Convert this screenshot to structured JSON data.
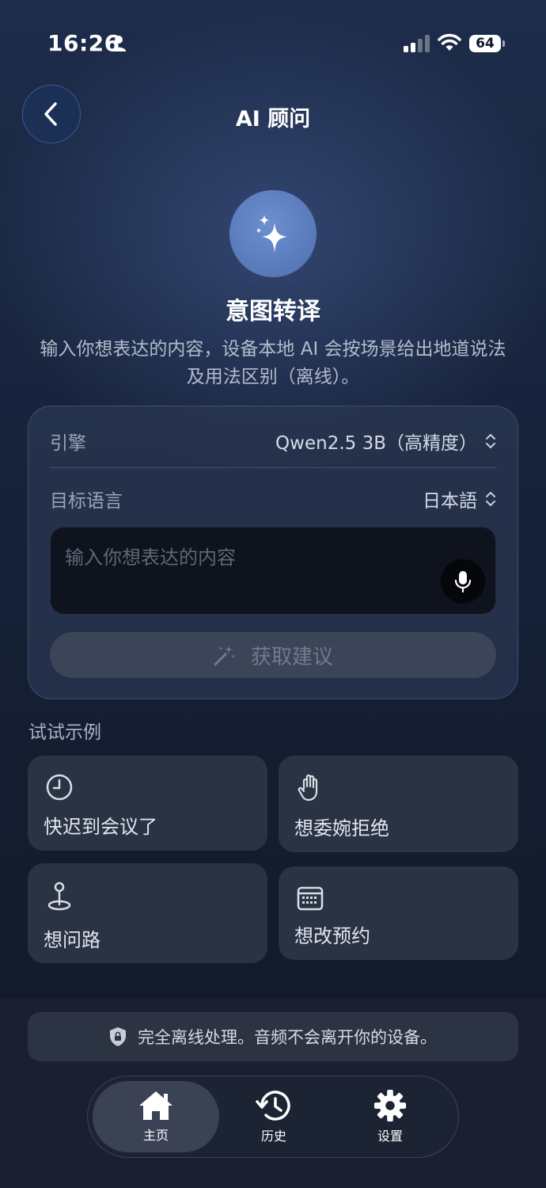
{
  "status_bar": {
    "time": "16:26",
    "battery": "64"
  },
  "header": {
    "title": "AI 顾问"
  },
  "hero": {
    "title": "意图转译",
    "description": "输入你想表达的内容，设备本地 AI 会按场景给出地道说法及用法区别（离线）。"
  },
  "form": {
    "engine_label": "引擎",
    "engine_value": "Qwen2.5 3B（高精度）",
    "language_label": "目标语言",
    "language_value": "日本語",
    "input_placeholder": "输入你想表达的内容",
    "input_value": "",
    "submit_label": "获取建议"
  },
  "examples": {
    "title": "试试示例",
    "items": [
      {
        "label": "快迟到会议了",
        "icon": "clock-icon"
      },
      {
        "label": "想委婉拒绝",
        "icon": "hand-icon"
      },
      {
        "label": "想问路",
        "icon": "map-pin-icon"
      },
      {
        "label": "想改预约",
        "icon": "calendar-icon"
      }
    ]
  },
  "footer": {
    "offline_note": "完全离线处理。音频不会离开你的设备。"
  },
  "tabbar": {
    "items": [
      {
        "label": "主页",
        "icon": "home-icon",
        "active": true
      },
      {
        "label": "历史",
        "icon": "history-icon",
        "active": false
      },
      {
        "label": "设置",
        "icon": "gear-icon",
        "active": false
      }
    ]
  },
  "colors": {
    "accent": "#5b7cc0",
    "card": "#2a3344",
    "background": "#18243d"
  }
}
